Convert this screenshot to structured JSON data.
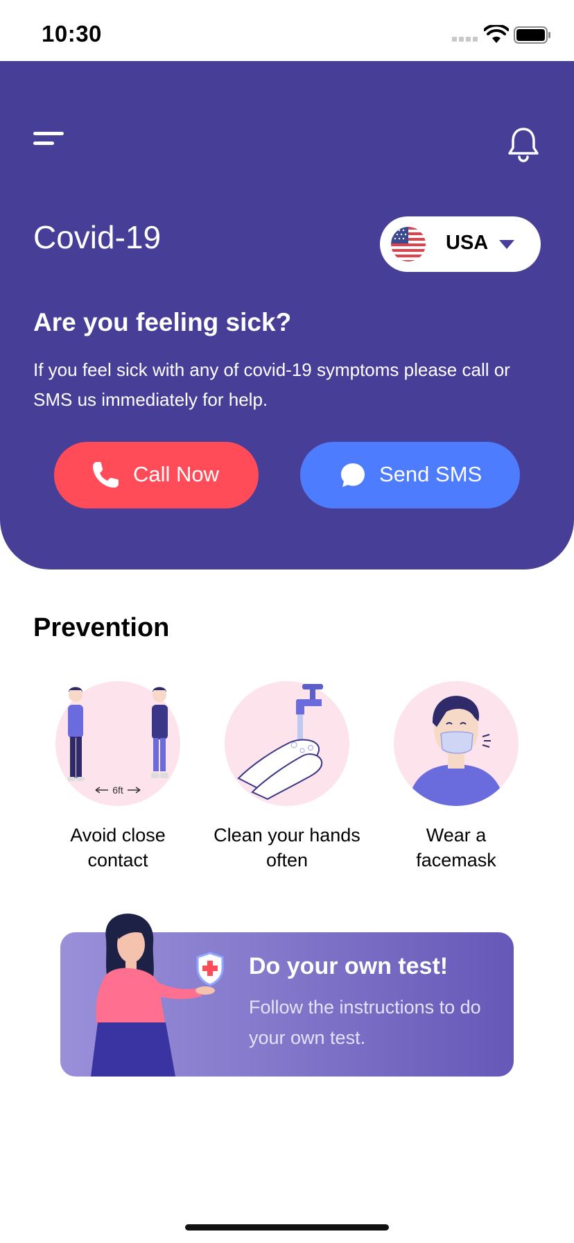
{
  "status_bar": {
    "time": "10:30"
  },
  "header": {
    "title": "Covid-19",
    "country": {
      "label": "USA",
      "flag_icon": "us-flag-icon"
    },
    "sick_title": "Are you feeling sick?",
    "sick_description": "If you feel sick with any of covid-19 symptoms please call or SMS us immediately for help.",
    "call_button": "Call Now",
    "sms_button": "Send SMS",
    "colors": {
      "background": "#473f97",
      "call": "#ff4c58",
      "sms": "#4d7cfe"
    }
  },
  "prevention": {
    "title": "Prevention",
    "items": [
      {
        "label": "Avoid close contact",
        "line1": "Avoid close",
        "line2": "contact",
        "distance_label": "6ft",
        "icon": "social-distance-illustration"
      },
      {
        "label": "Clean your hands often",
        "line1": "Clean your hands",
        "line2": "often",
        "icon": "handwash-illustration"
      },
      {
        "label": "Wear a facemask",
        "line1": "Wear a",
        "line2": "facemask",
        "icon": "facemask-illustration"
      }
    ]
  },
  "banner": {
    "title": "Do your own test!",
    "description": "Follow the instructions to do your own test."
  }
}
